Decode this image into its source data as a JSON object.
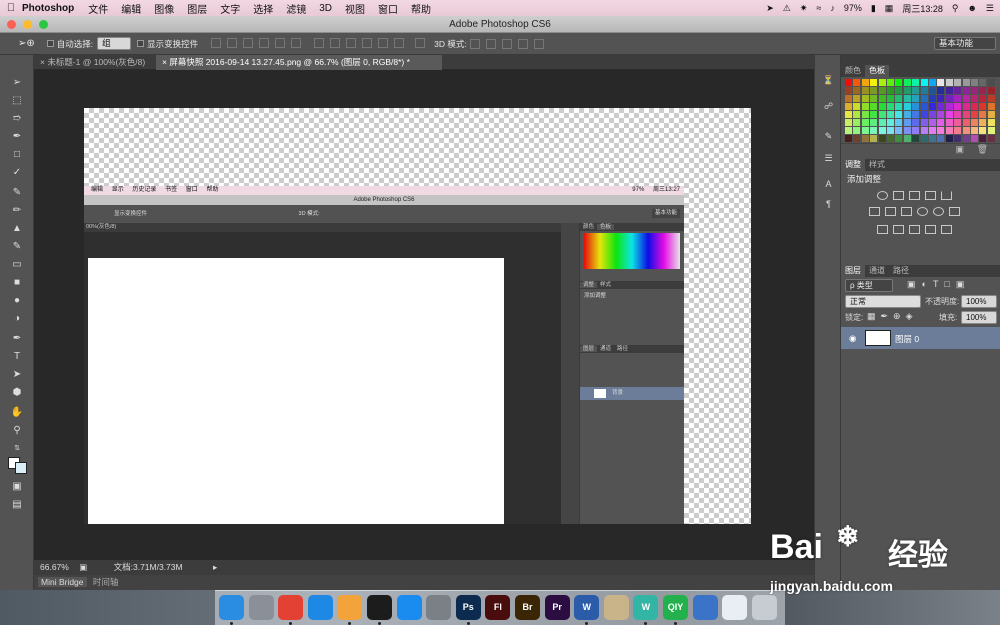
{
  "menubar": {
    "app": "Photoshop",
    "items": [
      "文件",
      "编辑",
      "图像",
      "图层",
      "文字",
      "选择",
      "滤镜",
      "3D",
      "视图",
      "窗口",
      "帮助"
    ],
    "battery": "97%",
    "clock": "周三13:28"
  },
  "window": {
    "title": "Adobe Photoshop CS6"
  },
  "options": {
    "auto_select_label": "自动选择:",
    "auto_select_value": "组",
    "show_transform_label": "显示变换控件",
    "mode3d_label": "3D 模式:",
    "workspace": "基本功能"
  },
  "tabs": [
    {
      "label": "未标题-1 @ 100%(灰色/8)"
    },
    {
      "label": "屏幕快照 2016-09-14 13.27.45.png @ 66.7% (图层 0, RGB/8*) *"
    }
  ],
  "inner": {
    "menu": [
      "编辑",
      "显示",
      "历史记录",
      "书签",
      "窗口",
      "帮助"
    ],
    "battery": "97%",
    "clock": "周三13:27",
    "title": "Adobe Photoshop CS6",
    "show_transform": "显示变换控件",
    "mode3d": "3D 模式:",
    "workspace": "基本功能",
    "tab": "00%(灰色/8)",
    "panels": {
      "swatch_tabs": [
        "颜色",
        "色板"
      ],
      "adjust_tabs": [
        "调整",
        "样式"
      ],
      "adjust_title": "添加调整",
      "layer_tabs": [
        "图层",
        "通道",
        "路径"
      ],
      "layer_name": "背景"
    }
  },
  "panels": {
    "swatch_tabs": [
      "颜色",
      "色板"
    ],
    "adjust_tabs": [
      "调整",
      "样式"
    ],
    "adjust_title": "添加调整",
    "layer_tabs": [
      "图层",
      "通道",
      "路径"
    ],
    "kind": "ρ 类型",
    "blend": "正常",
    "opacity_label": "不透明度:",
    "opacity": "100%",
    "lock_label": "锁定:",
    "fill_label": "填充:",
    "fill": "100%",
    "layer_name": "图层 0"
  },
  "status": {
    "zoom": "66.67%",
    "doc": "文档:3.71M/3.73M"
  },
  "bottom_tabs": [
    "Mini Bridge",
    "时间轴"
  ],
  "dock": [
    {
      "name": "finder-icon",
      "color": "#2b8de2",
      "label": ""
    },
    {
      "name": "launchpad-icon",
      "color": "#8a8f98",
      "label": ""
    },
    {
      "name": "chrome-icon",
      "color": "#e34133",
      "label": ""
    },
    {
      "name": "safari-icon",
      "color": "#1e88e5",
      "label": ""
    },
    {
      "name": "photos-icon",
      "color": "#f2a33a",
      "label": ""
    },
    {
      "name": "qq-icon",
      "color": "#1c1c1c",
      "label": ""
    },
    {
      "name": "app-store-icon",
      "color": "#1a8cf0",
      "label": ""
    },
    {
      "name": "system-preferences-icon",
      "color": "#7b8087",
      "label": ""
    },
    {
      "name": "photoshop-icon",
      "color": "#0d2b4e",
      "label": "Ps"
    },
    {
      "name": "flash-icon",
      "color": "#4a0d0d",
      "label": "Fl"
    },
    {
      "name": "bridge-icon",
      "color": "#3a2605",
      "label": "Br"
    },
    {
      "name": "premiere-icon",
      "color": "#2c0d42",
      "label": "Pr"
    },
    {
      "name": "word-icon",
      "color": "#2a5caa",
      "label": "W"
    },
    {
      "name": "preview-icon",
      "color": "#c9b48a",
      "label": ""
    },
    {
      "name": "wechat-icon",
      "color": "#32b5a5",
      "label": "W"
    },
    {
      "name": "iqiyi-icon",
      "color": "#22b14c",
      "label": "QIY"
    },
    {
      "name": "qq-browser-icon",
      "color": "#3b73c8",
      "label": ""
    },
    {
      "name": "mail-icon",
      "color": "#e8eef4",
      "label": ""
    },
    {
      "name": "trash-icon",
      "color": "#c7ccd2",
      "label": ""
    }
  ],
  "watermark": {
    "brand": "Bai",
    "brand_cn": "经验",
    "url": "jingyan.baidu.com"
  }
}
